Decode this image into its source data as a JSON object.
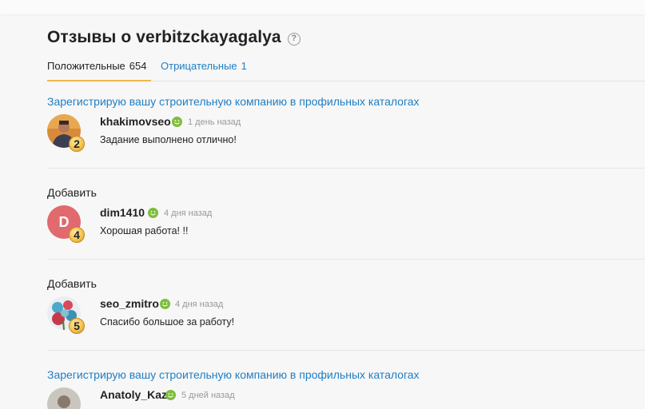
{
  "page": {
    "title": "Отзывы о verbitzckayagalya",
    "help_label": "?"
  },
  "tabs": {
    "positive": {
      "label": "Положительные",
      "count": "654"
    },
    "negative": {
      "label": "Отрицательные",
      "count": "1"
    }
  },
  "reviews": [
    {
      "title": "Зарегистрирую вашу строительную компанию в профильных каталогах",
      "title_is_link": true,
      "user": "khakimovseo",
      "level": "2",
      "time": "1 день назад",
      "comment": "Задание выполнено отлично!",
      "avatar_icon": "photo-avatar"
    },
    {
      "title": "Добавить",
      "title_is_link": false,
      "user": "dim1410",
      "level": "4",
      "avatar_letter": "D",
      "time": "4 дня назад",
      "comment": "Хорошая работа! !!"
    },
    {
      "title": "Добавить",
      "title_is_link": false,
      "user": "seo_zmitro",
      "level": "5",
      "time": "4 дня назад",
      "comment": "Спасибо большое за работу!",
      "avatar_icon": "flowers-avatar"
    },
    {
      "title": "Зарегистрирую вашу строительную компанию в профильных каталогах",
      "title_is_link": true,
      "user": "Anatoly_Kaz",
      "time": "5 дней назад",
      "avatar_icon": "photo-avatar"
    }
  ],
  "colors": {
    "link": "#1f7ec4",
    "tab_underline": "#f0b94a",
    "positive_badge": "#7dbd3c",
    "letter_avatar": "#e06a6e"
  }
}
